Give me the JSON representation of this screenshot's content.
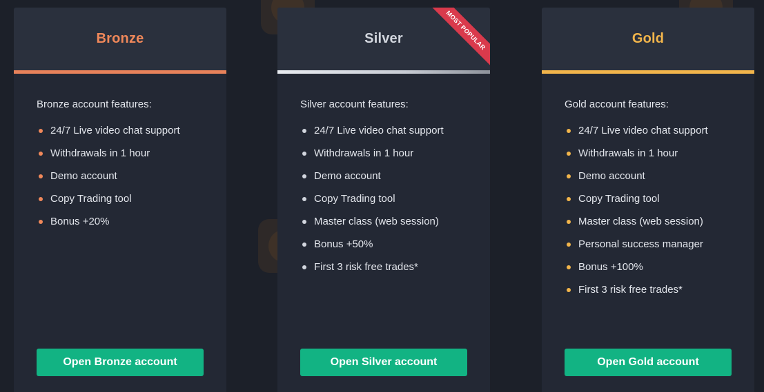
{
  "colors": {
    "bronze": "#f0885a",
    "silver": "#d2d6de",
    "gold": "#f2b54b",
    "button": "#12b383",
    "ribbon": "#d93a4c"
  },
  "plans": [
    {
      "title": "Bronze",
      "features_heading": "Bronze account features:",
      "features": [
        "24/7 Live video chat support",
        "Withdrawals in 1 hour",
        "Demo account",
        "Copy Trading tool",
        "Bonus +20%"
      ],
      "button_label": "Open Bronze account"
    },
    {
      "title": "Silver",
      "badge": "MOST POPULAR",
      "features_heading": "Silver account features:",
      "features": [
        "24/7 Live video chat support",
        "Withdrawals in 1 hour",
        "Demo account",
        "Copy Trading tool",
        "Master class (web session)",
        "Bonus +50%",
        "First 3 risk free trades*"
      ],
      "button_label": "Open Silver account"
    },
    {
      "title": "Gold",
      "features_heading": "Gold account features:",
      "features": [
        "24/7 Live video chat support",
        "Withdrawals in 1 hour",
        "Demo account",
        "Copy Trading tool",
        "Master class (web session)",
        "Personal success manager",
        "Bonus +100%",
        "First 3 risk free trades*"
      ],
      "button_label": "Open Gold account"
    }
  ]
}
